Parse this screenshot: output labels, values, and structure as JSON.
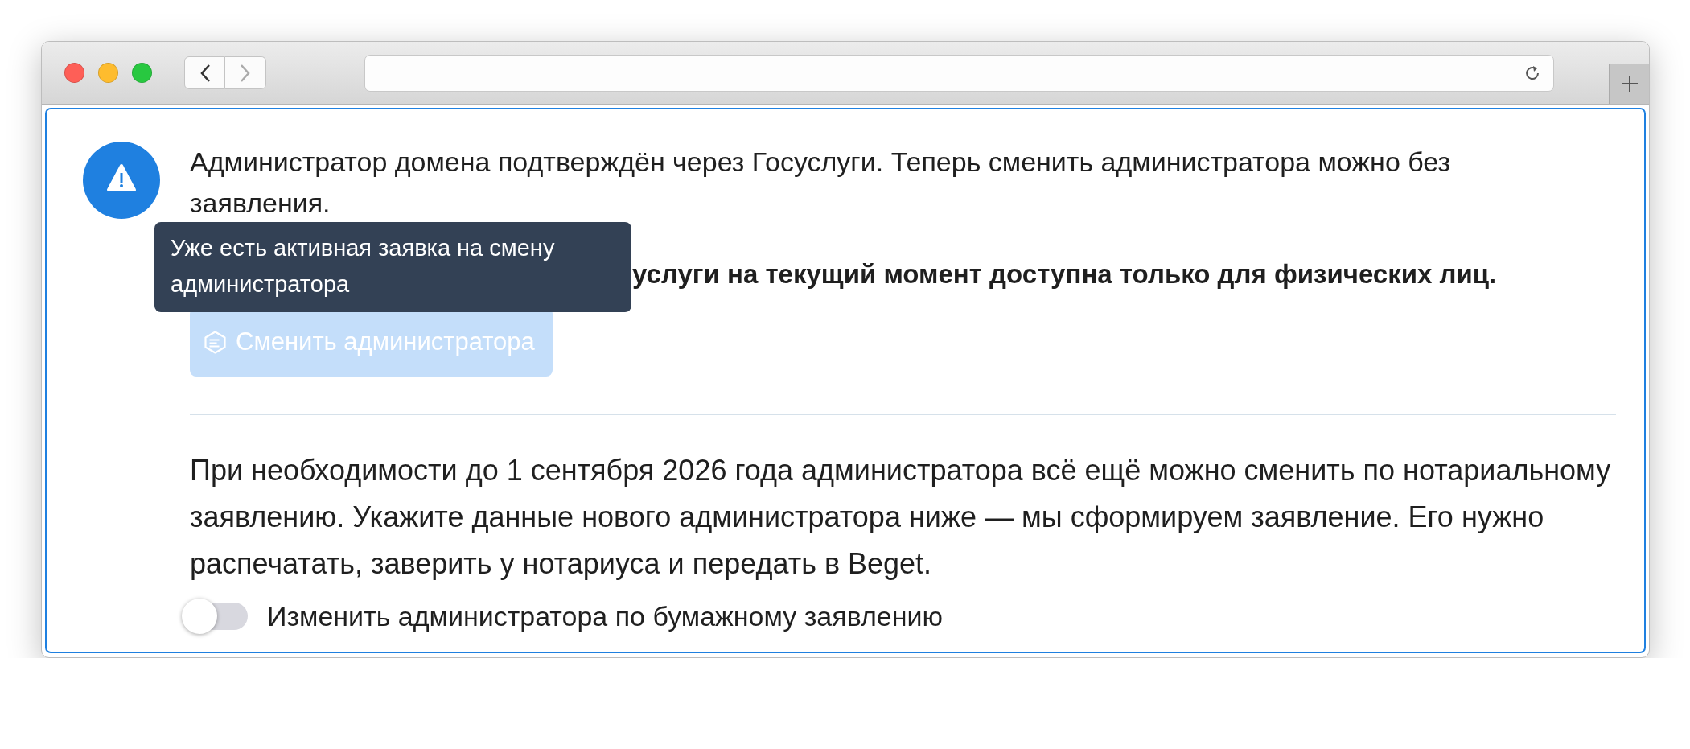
{
  "notice": {
    "text": "Администратор домена подтверждён через Госуслуги. Теперь сменить администратора можно без заявления.",
    "bold_note": "услуги на текущий момент доступна только для физических лиц."
  },
  "tooltip": {
    "text": "Уже есть активная заявка на смену администратора"
  },
  "change_button": {
    "label": "Сменить администратора",
    "disabled": true
  },
  "paper_info": "При необходимости до 1 сентября 2026 года администратора всё ещё можно сменить по нотариальному заявлению. Укажите данные нового администратора ниже — мы сформируем заявление. Его нужно распечатать, заверить у нотариуса и передать в Beget.",
  "paper_toggle": {
    "label": "Изменить администратора по бумажному заявлению",
    "on": false
  }
}
